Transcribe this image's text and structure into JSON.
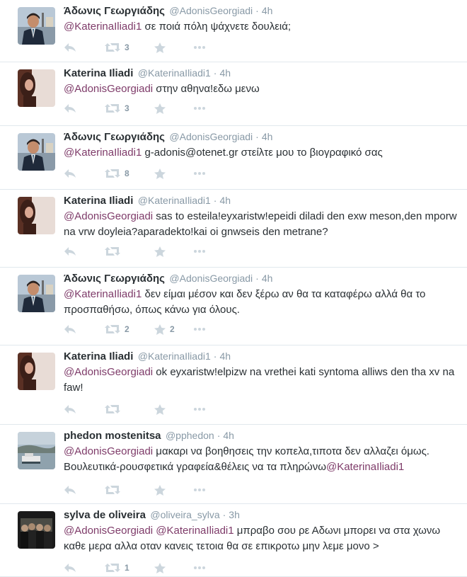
{
  "tweets": [
    {
      "name": "Άδωνις Γεωργιάδης",
      "handle": "@AdonisGeorgiadi",
      "time": "4h",
      "mention": "@KaterinaIliadi1",
      "text": " σε ποιά πόλη ψάχνετε δουλειά;",
      "retweets": "3",
      "favorites": "",
      "avatar": "adonis"
    },
    {
      "name": "Katerina Iliadi",
      "handle": "@KaterinaIliadi1",
      "time": "4h",
      "mention": "@AdonisGeorgiadi",
      "text": " στην αθηνα!εδω μενω",
      "retweets": "3",
      "favorites": "",
      "avatar": "katerina"
    },
    {
      "name": "Άδωνις Γεωργιάδης",
      "handle": "@AdonisGeorgiadi",
      "time": "4h",
      "mention": "@KaterinaIliadi1",
      "text": " g-adonis@otenet.gr στείλτε μου το βιογραφικό σας",
      "retweets": "8",
      "favorites": "",
      "avatar": "adonis"
    },
    {
      "name": "Katerina Iliadi",
      "handle": "@KaterinaIliadi1",
      "time": "4h",
      "mention": "@AdonisGeorgiadi",
      "text": " sas to esteila!eyxaristw!epeidi diladi den exw meson,den mporw na vrw doyleia?aparadekto!kai oi gnwseis den metrane?",
      "retweets": "",
      "favorites": "",
      "avatar": "katerina"
    },
    {
      "name": "Άδωνις Γεωργιάδης",
      "handle": "@AdonisGeorgiadi",
      "time": "4h",
      "mention": "@KaterinaIliadi1",
      "text": " δεν είμαι μέσον και δεν ξέρω αν θα τα καταφέρω αλλά θα το προσπαθήσω, όπως κάνω για όλους.",
      "retweets": "2",
      "favorites": "2",
      "avatar": "adonis"
    },
    {
      "name": "Katerina Iliadi",
      "handle": "@KaterinaIliadi1",
      "time": "4h",
      "mention": "@AdonisGeorgiadi",
      "text": " ok eyxaristw!elpizw na vrethei kati syntoma alliws den tha xv na faw!",
      "retweets": "",
      "favorites": "",
      "avatar": "katerina"
    },
    {
      "name": "phedon mostenitsa",
      "handle": "@pphedon",
      "time": "4h",
      "mention": "@AdonisGeorgiadi",
      "text": " μακαρι να βοηθησεις την κοπελα,τιποτα δεν αλλαζει όμως. Βουλευτικά-ρουσφετικά γραφεία&θέλεις να τα πληρώνω",
      "mention2": "@KaterinaIliadi1",
      "retweets": "",
      "favorites": "",
      "avatar": "phedon"
    },
    {
      "name": "sylva de oliveira",
      "handle": "@oliveira_sylva",
      "time": "3h",
      "mention": "@AdonisGeorgiadi",
      "mention_b": " @KaterinaIliadi1",
      "text": " μπραβο σου ρε Αδωνι μπορει να στα χωνω καθε μερα αλλα οταν κανεις τετοια θα σε επικροτω μην λεμε μονο >",
      "retweets": "1",
      "favorites": "",
      "avatar": "sylva"
    }
  ],
  "colors": {
    "mention": "#7e3b69",
    "meta": "#8899a6",
    "action_icon": "#ccd6dd",
    "divider": "#e1e8ed"
  },
  "icons": [
    "reply-icon",
    "retweet-icon",
    "favorite-icon",
    "more-icon"
  ]
}
